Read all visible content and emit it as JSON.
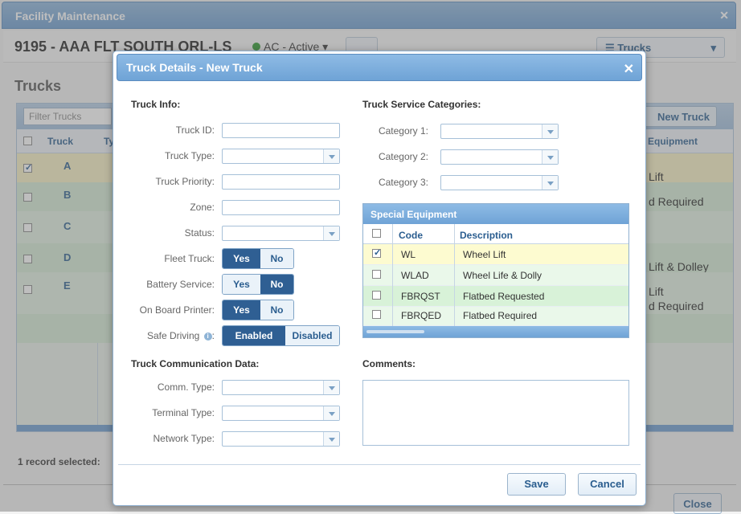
{
  "background": {
    "window_title": "Facility Maintenance",
    "facility": "9195 - AAA FLT SOUTH ORL-LS",
    "status": "AC - Active",
    "trucks_dropdown": "Trucks",
    "section_title": "Trucks",
    "filter_placeholder": "Filter Trucks",
    "new_truck_label": "New Truck",
    "columns": {
      "truck": "Truck",
      "type": "Ty",
      "equipment": "Equipment"
    },
    "rows": [
      {
        "truck": "A",
        "equipment": "Lift",
        "checked": true
      },
      {
        "truck": "B",
        "equipment": "d Required",
        "checked": false
      },
      {
        "truck": "C",
        "equipment": "",
        "checked": false
      },
      {
        "truck": "D",
        "equipment": "Lift & Dolley",
        "checked": false
      },
      {
        "truck": "E",
        "equipment": "Lift\nd Required",
        "checked": false
      }
    ],
    "records_selected": "1 record selected:",
    "close_label": "Close"
  },
  "modal": {
    "title": "Truck Details - New Truck",
    "truck_info_title": "Truck Info:",
    "fields": {
      "truck_id": {
        "label": "Truck ID:",
        "value": ""
      },
      "truck_type": {
        "label": "Truck Type:",
        "value": ""
      },
      "truck_priority": {
        "label": "Truck Priority:",
        "value": ""
      },
      "zone": {
        "label": "Zone:",
        "value": ""
      },
      "status": {
        "label": "Status:",
        "value": ""
      }
    },
    "toggles": {
      "fleet_truck": {
        "label": "Fleet Truck:",
        "left": "Yes",
        "right": "No",
        "selected": "Yes"
      },
      "battery_service": {
        "label": "Battery Service:",
        "left": "Yes",
        "right": "No",
        "selected": "No"
      },
      "on_board_printer": {
        "label": "On Board Printer:",
        "left": "Yes",
        "right": "No",
        "selected": "Yes"
      },
      "safe_driving": {
        "label": "Safe Driving",
        "info_icon": "info-icon",
        "left": "Enabled",
        "right": "Disabled",
        "selected": "Enabled"
      }
    },
    "comm_title": "Truck Communication Data:",
    "comm": {
      "comm_type": {
        "label": "Comm. Type:",
        "value": ""
      },
      "terminal_type": {
        "label": "Terminal Type:",
        "value": ""
      },
      "network_type": {
        "label": "Network Type:",
        "value": ""
      }
    },
    "service_title": "Truck Service Categories:",
    "categories": [
      {
        "label": "Category 1:",
        "value": ""
      },
      {
        "label": "Category 2:",
        "value": ""
      },
      {
        "label": "Category 3:",
        "value": ""
      }
    ],
    "special_equipment": {
      "title": "Special Equipment",
      "col_code": "Code",
      "col_desc": "Description",
      "rows": [
        {
          "code": "WL",
          "desc": "Wheel Lift",
          "checked": true,
          "bg": "#fdfbd0"
        },
        {
          "code": "WLAD",
          "desc": "Wheel Life & Dolly",
          "checked": false,
          "bg": "#eaf8ea"
        },
        {
          "code": "FBRQST",
          "desc": "Flatbed Requested",
          "checked": false,
          "bg": "#d8f2d8"
        },
        {
          "code": "FBRQED",
          "desc": "Flatbed Required",
          "checked": false,
          "bg": "#eaf8ea"
        }
      ]
    },
    "comments_title": "Comments:",
    "comments_value": "",
    "save_label": "Save",
    "cancel_label": "Cancel"
  },
  "colors": {
    "accent": "#2f5f93",
    "header": "#6fa3d6",
    "selected_row": "#fdfbd0"
  }
}
